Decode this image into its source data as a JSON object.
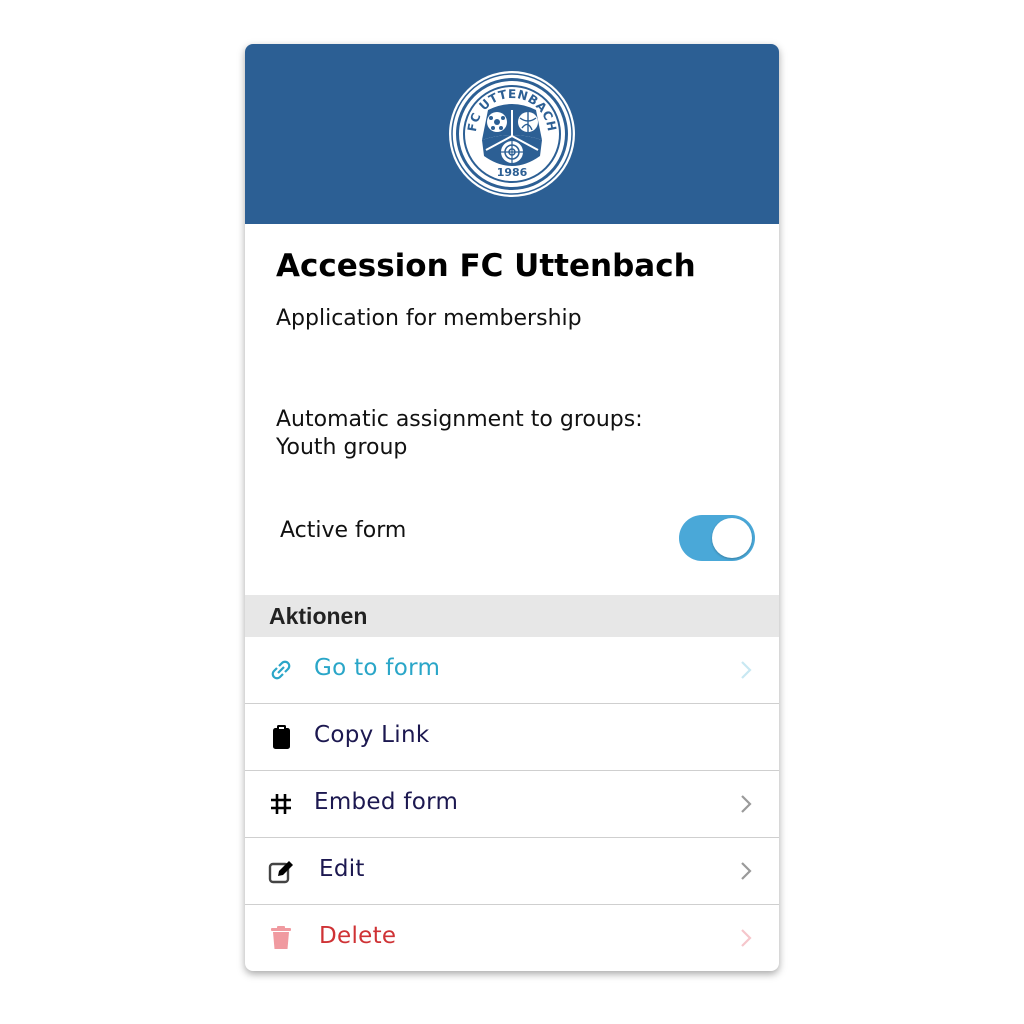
{
  "colors": {
    "banner": "#2c5f94",
    "toggle_on": "#4aa8d8",
    "link": "#2aa6c8",
    "action_text": "#1c1850",
    "delete": "#cf3235",
    "delete_icon": "#f09aa0",
    "chevron": "#9a9a9a",
    "chevron_light": "#c8e8f2",
    "chevron_delete": "#f5c6cb"
  },
  "logo": {
    "text_top": "FC UTTENBACH",
    "year": "1986"
  },
  "form": {
    "title": "Accession FC Uttenbach",
    "subtitle": "Application for membership",
    "assignment_label": "Automatic assignment to groups:",
    "assignment_value": "Youth group",
    "active_label": "Active form",
    "active": true
  },
  "actions": {
    "header": "Aktionen",
    "items": [
      {
        "label": "Go to form",
        "icon": "link-icon",
        "chevron": true
      },
      {
        "label": "Copy Link",
        "icon": "clipboard-icon",
        "chevron": false
      },
      {
        "label": "Embed form",
        "icon": "hash-icon",
        "chevron": true
      },
      {
        "label": "Edit",
        "icon": "edit-icon",
        "chevron": true
      },
      {
        "label": "Delete",
        "icon": "trash-icon",
        "chevron": true
      }
    ]
  }
}
